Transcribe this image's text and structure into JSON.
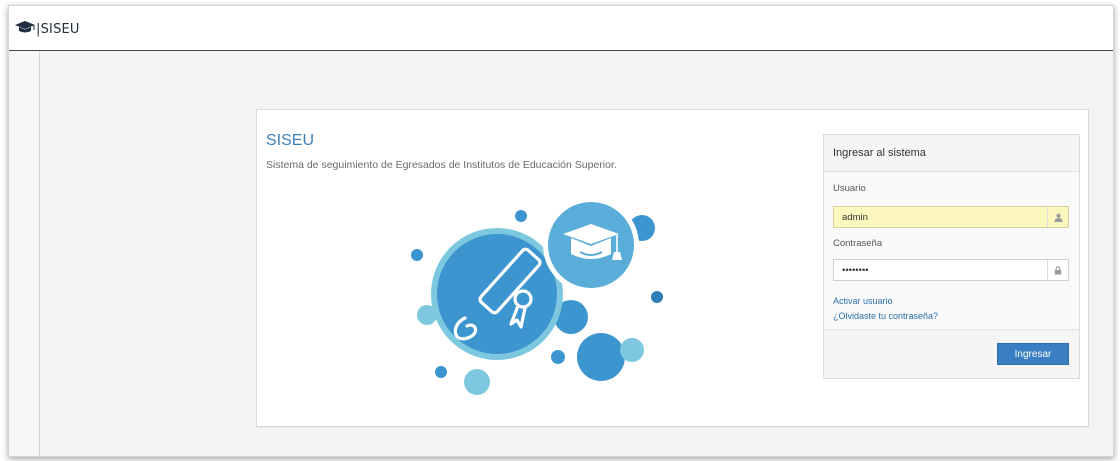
{
  "navbar": {
    "brand_text": "|SISEU",
    "logo_icon": "graduation-cap-icon"
  },
  "main": {
    "title": "SISEU",
    "subtitle": "Sistema de seguimiento de Egresados de Institutos de Educación Superior.",
    "illustration_icons": [
      "diploma-icon",
      "graduation-cap-icon"
    ]
  },
  "login": {
    "header": "Ingresar al sistema",
    "username_label": "Usuario",
    "username_value": "admin",
    "username_icon": "user-icon",
    "password_label": "Contraseña",
    "password_value": "••••••••",
    "password_icon": "lock-icon",
    "activate_link": "Activar usuario",
    "forgot_link": "¿Olvidaste tu contraseña?",
    "submit_label": "Ingresar"
  },
  "colors": {
    "accent": "#3a7fc1",
    "title": "#3c7fb8",
    "bubble_dark": "#3d95cf",
    "bubble_mid": "#5aadd9",
    "bubble_light": "#7ec8df",
    "autofill": "#fbf7bd"
  }
}
